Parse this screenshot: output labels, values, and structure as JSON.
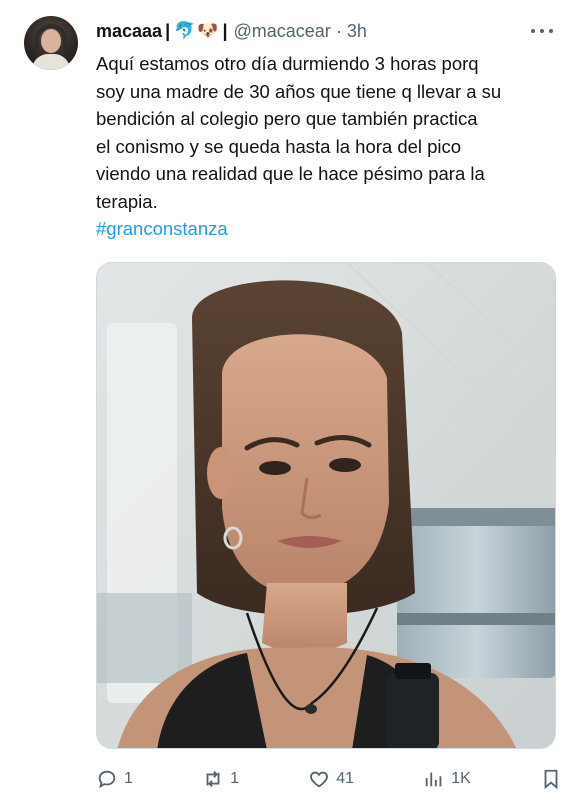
{
  "author": {
    "display_name": "macaaa",
    "separator": "|",
    "emojis": [
      "🐬",
      "🐶"
    ],
    "separator2": "|",
    "handle": "@macacear",
    "dot": "·",
    "time": "3h"
  },
  "tweet": {
    "lines": [
      "Aquí estamos otro día durmiendo 3 horas porq",
      "soy una madre de 30 años que tiene q llevar a su",
      "bendición al colegio pero que también practica",
      "el conismo y se queda hasta la hora del pico",
      "viendo una realidad que le hace pésimo para la",
      "terapia."
    ],
    "hashtag": "#granconstanza"
  },
  "actions": {
    "reply_icon": "reply-icon",
    "reply_count": "1",
    "retweet_icon": "retweet-icon",
    "retweet_count": "1",
    "like_icon": "heart-icon",
    "like_count": "41",
    "views_icon": "views-icon",
    "views_count": "1K",
    "bookmark_icon": "bookmark-icon"
  },
  "colors": {
    "text": "#0f1419",
    "secondary": "#536471",
    "link": "#1d9bf0",
    "border": "#cfd9de"
  }
}
